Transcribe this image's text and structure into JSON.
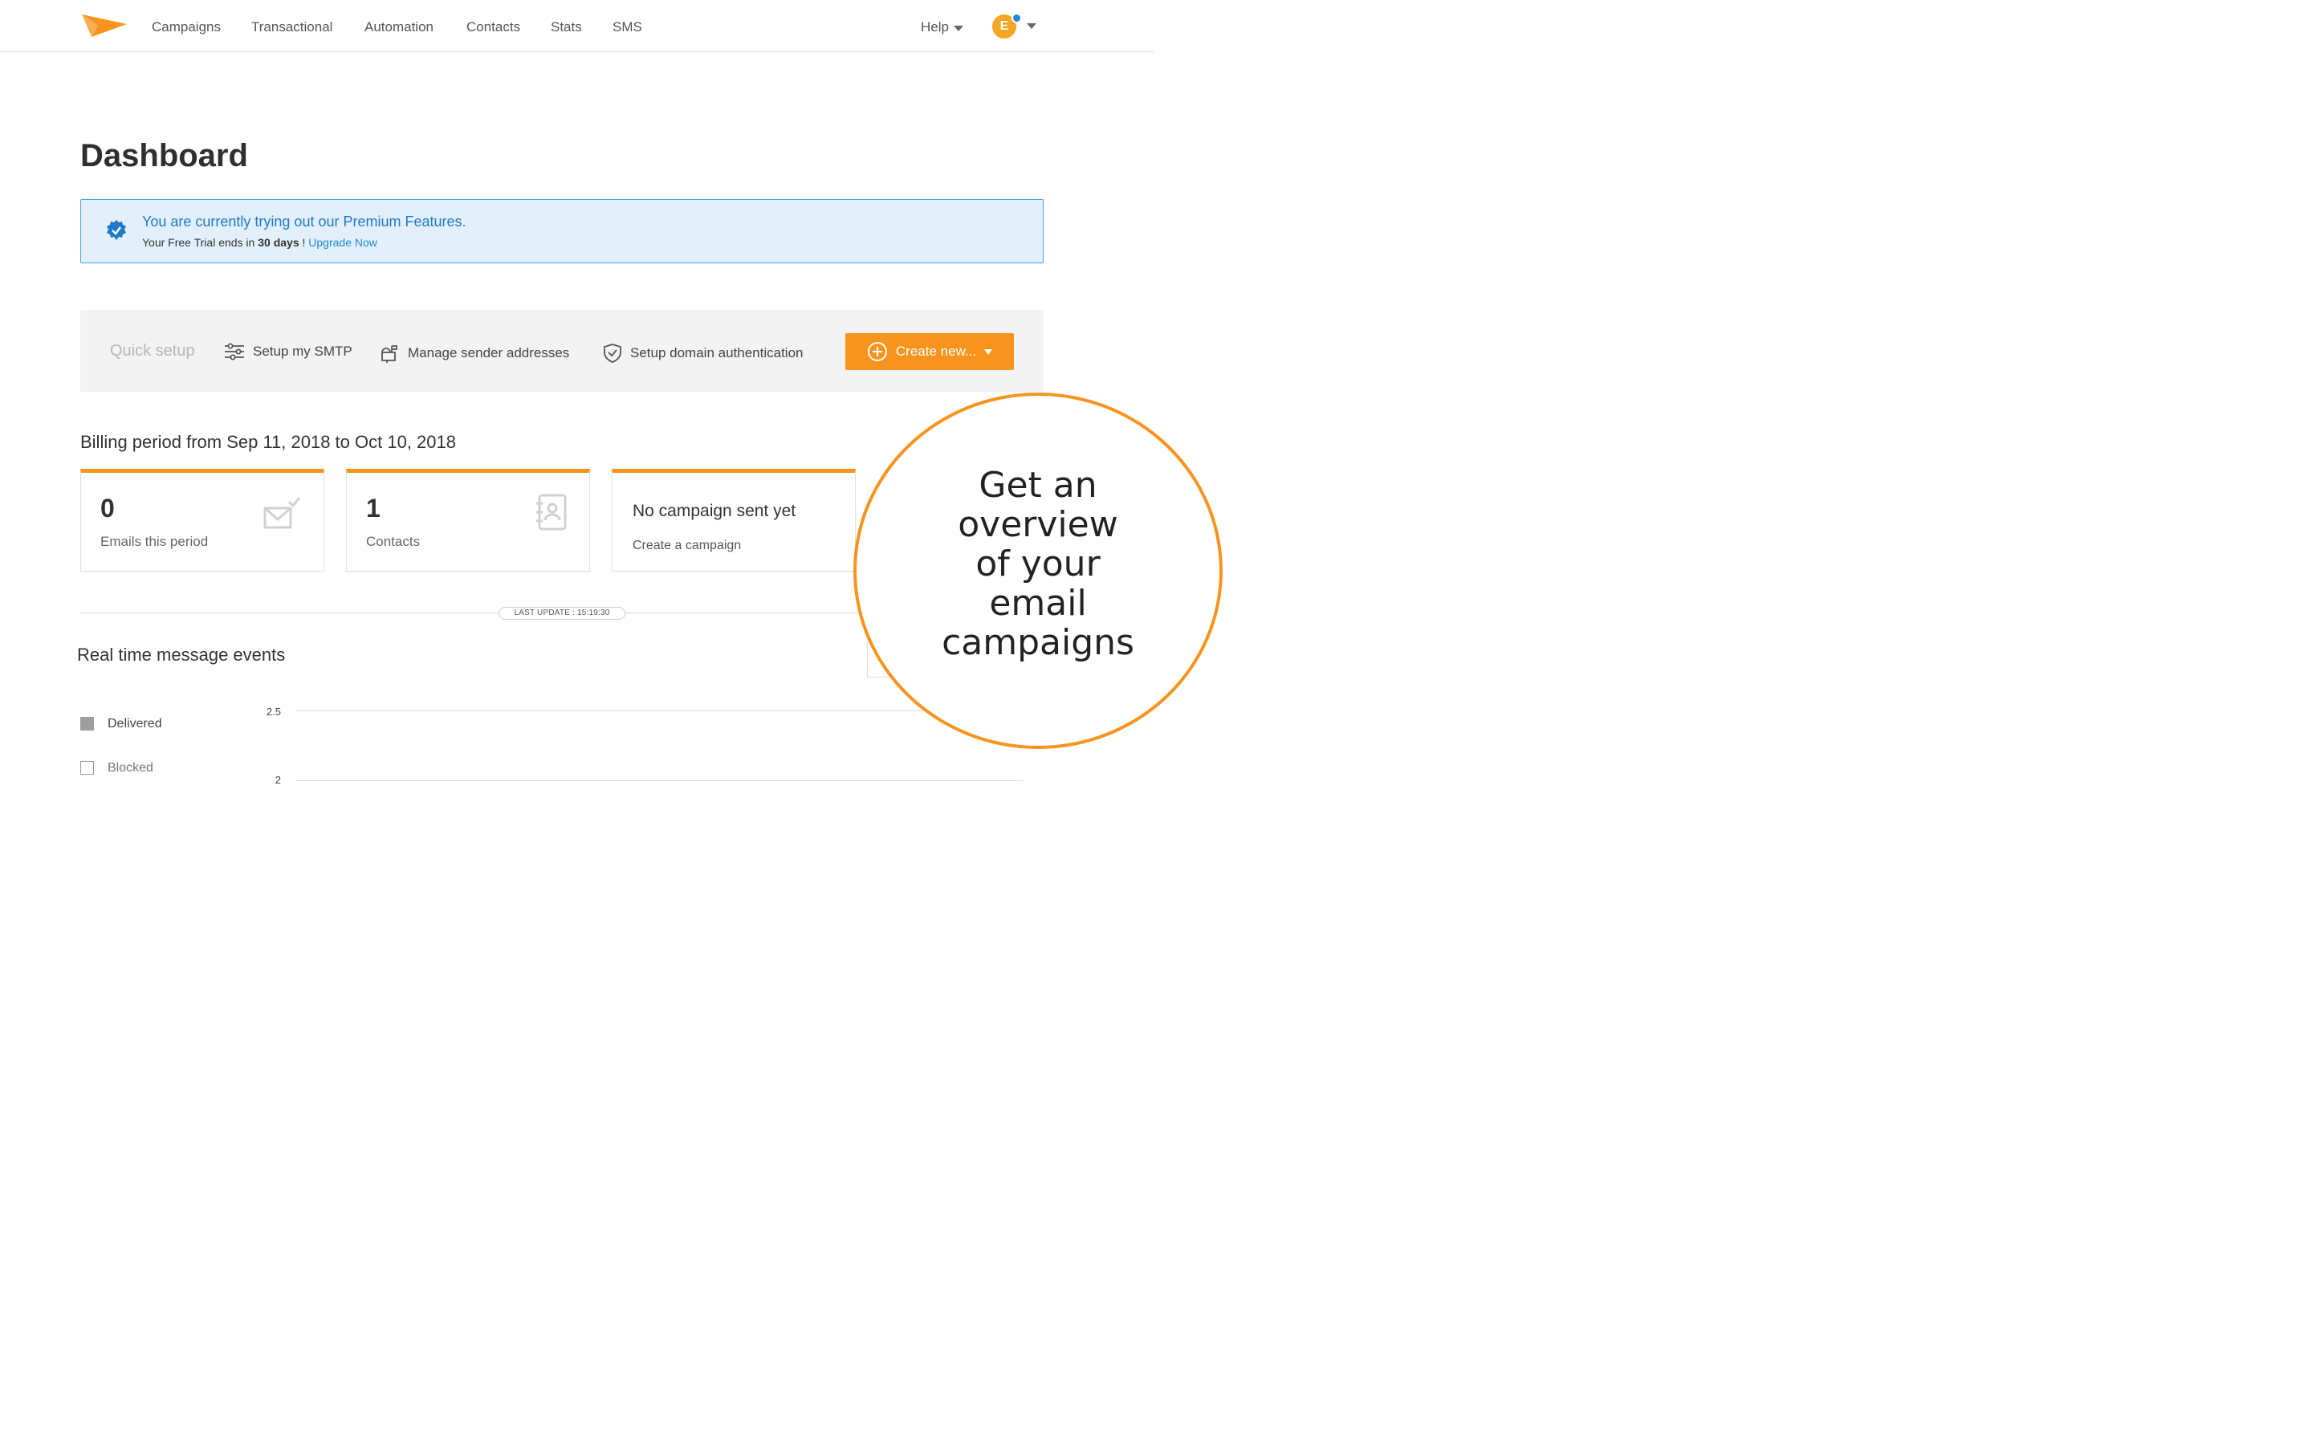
{
  "nav": {
    "items": [
      "Campaigns",
      "Transactional",
      "Automation",
      "Contacts",
      "Stats",
      "SMS"
    ],
    "help_label": "Help",
    "avatar_initial": "E"
  },
  "page_title": "Dashboard",
  "banner": {
    "title": "You are currently trying out our Premium Features.",
    "sub_prefix": "Your Free Trial ends in ",
    "sub_days": "30 days",
    "sub_suffix": " ! ",
    "upgrade_link": "Upgrade Now"
  },
  "quick_setup": {
    "label": "Quick setup",
    "items": [
      "Setup my SMTP",
      "Manage sender addresses",
      "Setup domain authentication"
    ],
    "create_button": "Create new..."
  },
  "billing_period": "Billing period from Sep 11, 2018 to Oct 10, 2018",
  "cards": [
    {
      "value": "0",
      "label": "Emails this period",
      "icon": "envelope-check-icon"
    },
    {
      "value": "1",
      "label": "Contacts",
      "icon": "address-book-icon"
    },
    {
      "title": "No campaign sent yet",
      "link": "Create a campaign"
    }
  ],
  "last_update": "LAST UPDATE : 15:19:30",
  "realtime": {
    "title": "Real time message events",
    "legend": [
      "Delivered",
      "Blocked"
    ],
    "y_ticks": [
      "2.5",
      "2"
    ]
  },
  "callout": {
    "lines": [
      "Get an",
      "overview",
      "of your",
      "email",
      "campaigns"
    ]
  },
  "colors": {
    "accent": "#f7941d",
    "link": "#1e88e5",
    "banner_bg": "#e3f0fb"
  }
}
